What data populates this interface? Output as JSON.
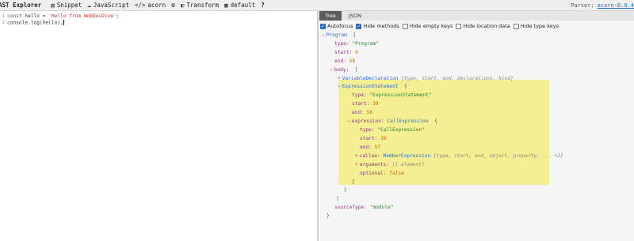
{
  "toolbar": {
    "title": "AST Explorer",
    "items": [
      {
        "icon": "snippet-icon",
        "label": "Snippet"
      },
      {
        "icon": "javascript-icon",
        "label": "JavaScript"
      },
      {
        "icon": "code-icon",
        "label": "acorn"
      },
      {
        "icon": "gear-icon",
        "label": ""
      },
      {
        "icon": "transform-icon",
        "label": "Transform"
      },
      {
        "icon": "default-icon",
        "label": "default"
      },
      {
        "icon": "help-icon",
        "label": ""
      }
    ],
    "parser_label": "Parser:",
    "parser_name": "acorn-8.0.4"
  },
  "editor": {
    "lines": [
      {
        "no": "1",
        "kw": "const",
        "rest": " hello = ",
        "str": "'Hello from WebDevDive'",
        "end": ";"
      },
      {
        "no": "2",
        "code": "console.log(hello);"
      }
    ]
  },
  "tabs": {
    "tree": "Tree",
    "json": "JSON"
  },
  "options": [
    {
      "label": "Autofocus",
      "checked": true
    },
    {
      "label": "Hide methods",
      "checked": true
    },
    {
      "label": "Hide empty keys",
      "checked": false
    },
    {
      "label": "Hide location data",
      "checked": false
    },
    {
      "label": "Hide type keys",
      "checked": false
    }
  ],
  "tree": {
    "program": "Program",
    "brace_open": "{",
    "brace_close": "}",
    "bracket_open": "[",
    "bracket_close": "]",
    "prog_type_key": "type:",
    "prog_type_val": "\"Program\"",
    "prog_start_key": "start:",
    "prog_start_val": "0",
    "prog_end_key": "end:",
    "prog_end_val": "58",
    "body_key": "body:",
    "vardecl": "VariableDeclaration",
    "vardecl_hint": "{type, start, end, declarations, kind}",
    "exprstmt": "ExpressionStatement",
    "es_type_key": "type:",
    "es_type_val": "\"ExpressionStatement\"",
    "es_start_key": "start:",
    "es_start_val": "39",
    "es_end_key": "end:",
    "es_end_val": "58",
    "expr_key": "expression:",
    "callexpr": "CallExpression",
    "ce_type_key": "type:",
    "ce_type_val": "\"CallExpression\"",
    "ce_start_key": "start:",
    "ce_start_val": "39",
    "ce_end_key": "end:",
    "ce_end_val": "57",
    "callee_key": "callee:",
    "memberexpr": "MemberExpression",
    "callee_hint": "{type, start, end, object, property, ... +2}",
    "args_key": "arguments:",
    "args_hint": "[1 element]",
    "optional_key": "optional:",
    "optional_val": "false",
    "srctype_key": "sourceType:",
    "srctype_val": "\"module\""
  },
  "colors": {
    "highlight": "#f4ef93",
    "accent": "#2a6ccb"
  }
}
